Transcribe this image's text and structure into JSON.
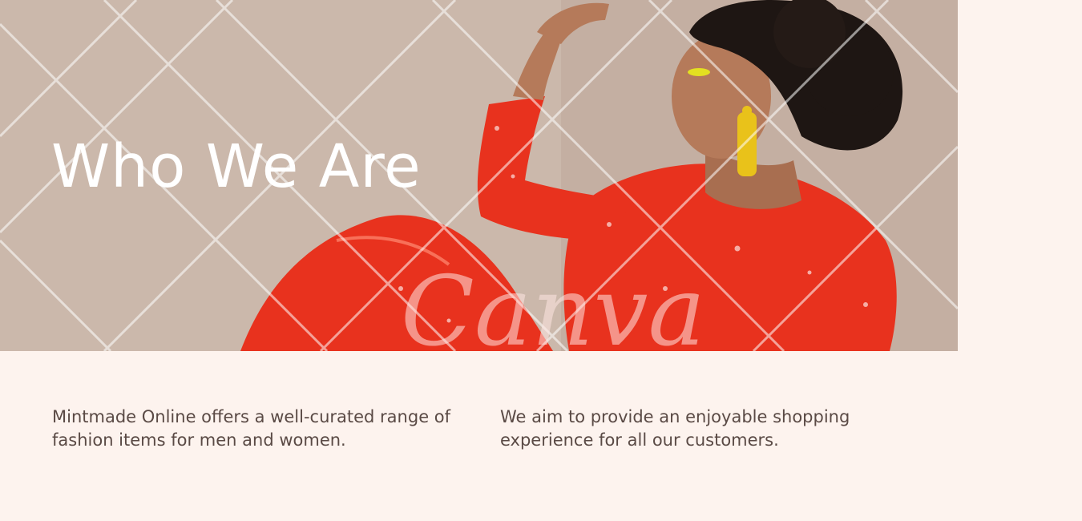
{
  "hero": {
    "title": "Who We Are",
    "watermark_text": "Canva",
    "colors": {
      "background": "#c9b5a8",
      "outfit": "#e8321e",
      "earring": "#e9c21a",
      "eyeshadow": "#e3e021",
      "hair": "#1e1613",
      "skin": "#b57a5a"
    }
  },
  "about": {
    "left_text": "Mintmade Online offers a well-curated range of fashion items for men and women.",
    "right_text": "We aim to provide an enjoyable shopping experience for all our customers."
  },
  "colors": {
    "page_background": "#fdf3ee",
    "body_text": "#5a4a45",
    "title_text": "#ffffff"
  }
}
